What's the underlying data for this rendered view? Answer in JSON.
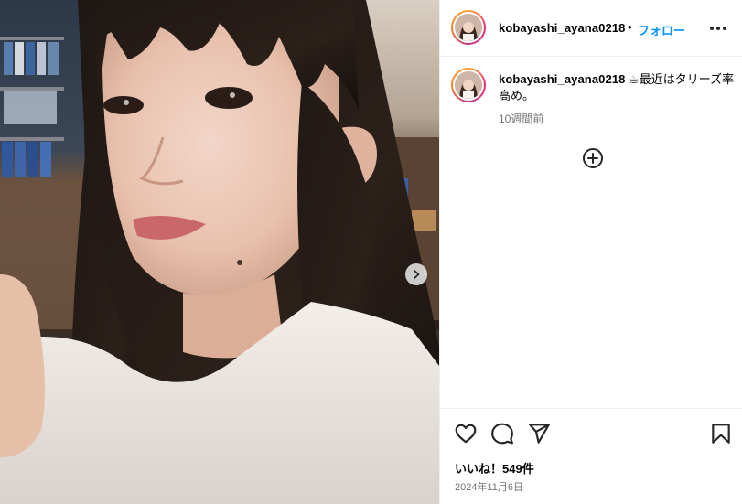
{
  "post": {
    "username": "kobayashi_ayana0218",
    "separator": "•",
    "follow_label": "フォロー",
    "caption": "☕最近はタリーズ率高め。",
    "time_ago": "10週間前",
    "likes": "いいね！549件",
    "date": "2024年11月6日"
  },
  "icons": {
    "more": "more-options-icon",
    "add_comment": "add-circle-icon",
    "like": "heart-icon",
    "comment": "comment-icon",
    "share": "send-icon",
    "save": "bookmark-icon",
    "next": "chevron-right-icon"
  },
  "colors": {
    "accent": "#0095f6",
    "muted": "#737373",
    "divider": "#efefef"
  }
}
